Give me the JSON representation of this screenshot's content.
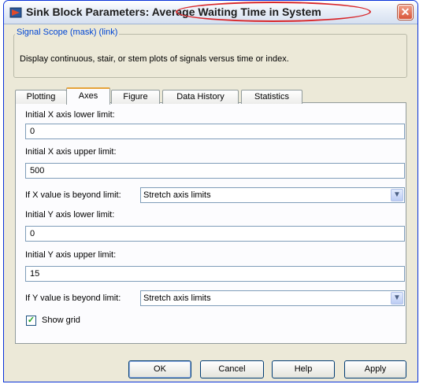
{
  "window": {
    "title_prefix": "Sink Block Parameters",
    "title_suffix": ": Average Waiting Time in System",
    "close_glyph": "✕"
  },
  "group": {
    "legend": "Signal Scope (mask) (link)",
    "description": "Display continuous, stair, or stem plots of signals versus time or index."
  },
  "tabs": [
    {
      "label": "Plotting"
    },
    {
      "label": "Axes"
    },
    {
      "label": "Figure"
    },
    {
      "label": "Data History"
    },
    {
      "label": "Statistics"
    }
  ],
  "active_tab": "Axes",
  "fields": {
    "x_lower_label": "Initial X axis lower limit:",
    "x_lower_value": "0",
    "x_upper_label": "Initial X axis upper limit:",
    "x_upper_value": "500",
    "x_beyond_label": "If X value is beyond limit:",
    "x_beyond_value": "Stretch axis limits",
    "y_lower_label": "Initial Y axis lower limit:",
    "y_lower_value": "0",
    "y_upper_label": "Initial Y axis upper limit:",
    "y_upper_value": "15",
    "y_beyond_label": "If Y value is beyond limit:",
    "y_beyond_value": "Stretch axis limits"
  },
  "show_grid": {
    "label": "Show grid",
    "checked": true
  },
  "buttons": {
    "ok": "OK",
    "cancel": "Cancel",
    "help": "Help",
    "apply": "Apply"
  },
  "colors": {
    "title_highlight": "#d8262a",
    "legend_text": "#0046d5",
    "active_tab_accent": "#e6a33a",
    "close_button": "#d8553a"
  }
}
